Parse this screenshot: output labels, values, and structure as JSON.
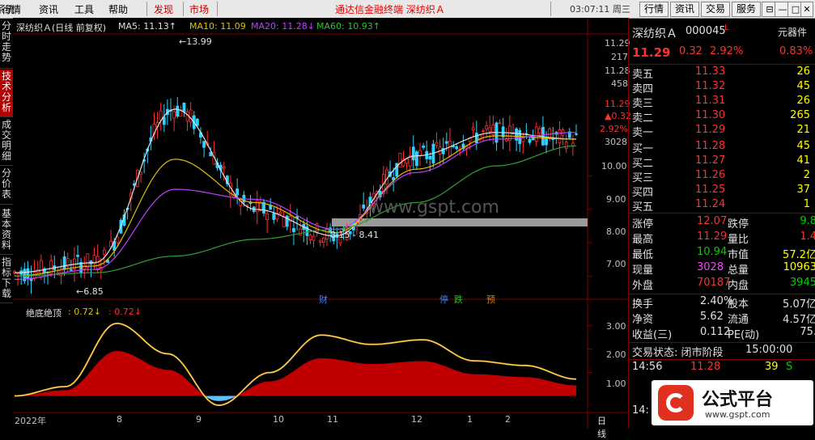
{
  "menu": {
    "items": [
      "系统",
      "行情",
      "资讯",
      "工具",
      "帮助"
    ],
    "red_items": [
      "发现",
      "市场"
    ],
    "title": "通达信金融终端   深纺织Ａ",
    "clock": "03:07:11 周三",
    "buttons": [
      "行情",
      "资讯",
      "交易",
      "服务"
    ],
    "window_buttons": [
      "⊟",
      "—",
      "□",
      "✕"
    ]
  },
  "left_tabs": [
    "分时走势",
    "技术分析",
    "成交明细",
    "分价表",
    "基本资料",
    "指标下载"
  ],
  "chart": {
    "stock_title": "深纺织Ａ(日线 前复权)",
    "ma5": "MA5: 11.13↑",
    "ma10": "MA10: 11.09",
    "ma20": "MA20: 11.28↓",
    "ma60": "MA60: 10.93↑",
    "price_axis": [
      "11.29",
      "217",
      "11.28",
      "458",
      "11.29",
      "▲0.32",
      "2.92%",
      "3028",
      "10.00",
      "9.00",
      "8.00",
      "7.00"
    ],
    "peak_label": "←13.99",
    "low_label": "←6.85",
    "range_label": "8.15 - 8.41",
    "watermark": "www.gspt.com",
    "event_labels": [
      "财",
      "停",
      "跌",
      "预"
    ],
    "indicator_name": "绝底绝顶",
    "indicator_v1": ": 0.72↓",
    "indicator_v2": ": 0.72↓",
    "indicator_axis": [
      "3.00",
      "2.00",
      "1.00"
    ],
    "x_axis": [
      "2022年",
      "8",
      "9",
      "10",
      "11",
      "12",
      "1",
      "2"
    ],
    "period_label": "日线"
  },
  "quote": {
    "name": "深纺织Ａ",
    "code": "000045",
    "flag": "L",
    "badge": "元器件",
    "price": "11.29",
    "change": "0.32",
    "pct": "2.92%",
    "badge_pct": "0.83%",
    "sells": [
      {
        "label": "卖五",
        "price": "11.33",
        "vol": "26"
      },
      {
        "label": "卖四",
        "price": "11.32",
        "vol": "45"
      },
      {
        "label": "卖三",
        "price": "11.31",
        "vol": "26"
      },
      {
        "label": "卖二",
        "price": "11.30",
        "vol": "265"
      },
      {
        "label": "卖一",
        "price": "11.29",
        "vol": "21"
      }
    ],
    "buys": [
      {
        "label": "买一",
        "price": "11.28",
        "vol": "45"
      },
      {
        "label": "买二",
        "price": "11.27",
        "vol": "41"
      },
      {
        "label": "买三",
        "price": "11.26",
        "vol": "2"
      },
      {
        "label": "买四",
        "price": "11.25",
        "vol": "37"
      },
      {
        "label": "买五",
        "price": "11.24",
        "vol": "1"
      }
    ],
    "stats": [
      {
        "l1": "涨停",
        "v1": "12.07",
        "l2": "跌停",
        "v2": "9.8"
      },
      {
        "l1": "最高",
        "v1": "11.29",
        "l2": "量比",
        "v2": "1.4"
      },
      {
        "l1": "最低",
        "v1": "10.94",
        "l2": "市值",
        "v2": "57.2亿"
      },
      {
        "l1": "现量",
        "v1": "3028",
        "l2": "总量",
        "v2": "10963"
      },
      {
        "l1": "外盘",
        "v1": "70187",
        "l2": "内盘",
        "v2": "3945"
      }
    ],
    "stats2": [
      {
        "l1": "换手",
        "v1": "2.40%",
        "l2": "股本",
        "v2": "5.07亿"
      },
      {
        "l1": "净资",
        "v1": "5.62",
        "l2": "流通",
        "v2": "4.57亿"
      },
      {
        "l1": "收益(三)",
        "v1": "0.112",
        "l2": "PE(动)",
        "v2": "75."
      }
    ],
    "status_label": "交易状态: 闭市阶段",
    "status_time": "15:00:00",
    "tick_time": "14:56",
    "tick_price": "11.28",
    "tick_vol": "39",
    "tick_side": "S",
    "tick2_time": "14:",
    "logo_text": "公式平台",
    "logo_url": "www.gspt.com"
  },
  "chart_data": {
    "type": "line",
    "title": "深纺织Ａ(日线 前复权)",
    "x": [
      "2022年",
      "8",
      "9",
      "10",
      "11",
      "12",
      "1",
      "2"
    ],
    "ylim": [
      6.5,
      14.2
    ],
    "series": [
      {
        "name": "MA5",
        "values": [
          7.1,
          7.4,
          12.0,
          9.0,
          8.2,
          10.6,
          11.3,
          11.1
        ]
      },
      {
        "name": "MA10",
        "values": [
          7.0,
          7.3,
          10.5,
          9.2,
          8.3,
          10.2,
          11.2,
          11.1
        ]
      },
      {
        "name": "MA20",
        "values": [
          6.9,
          7.2,
          9.6,
          9.3,
          8.4,
          10.1,
          11.1,
          11.3
        ]
      },
      {
        "name": "MA60",
        "values": [
          7.0,
          7.1,
          7.6,
          8.1,
          8.4,
          9.2,
          10.3,
          10.9
        ]
      }
    ],
    "indicator": {
      "name": "绝底绝顶",
      "ylim": [
        -0.5,
        3.3
      ],
      "values": [
        0.0,
        0.4,
        3.1,
        1.8,
        -0.4,
        1.0,
        2.6,
        2.2,
        2.4,
        1.5,
        1.3,
        0.72
      ]
    }
  }
}
